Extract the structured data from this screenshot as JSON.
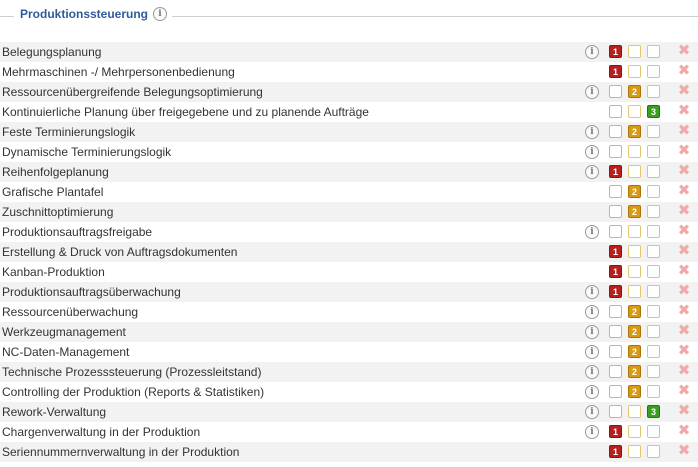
{
  "header": {
    "title": "Produktionssteuerung",
    "info_icon": "info-icon"
  },
  "colors": {
    "level1": "#b52121",
    "level2": "#d99a12",
    "level3": "#3a9f1f",
    "title": "#2f5b9c",
    "delete": "#f0a9a9"
  },
  "rows": [
    {
      "label": "Belegungsplanung",
      "info": true,
      "selected": 1
    },
    {
      "label": "Mehrmaschinen -/ Mehrpersonenbedienung",
      "info": false,
      "selected": 1
    },
    {
      "label": "Ressourcenübergreifende Belegungsoptimierung",
      "info": true,
      "selected": 2
    },
    {
      "label": "Kontinuierliche Planung über freigegebene und zu planende Aufträge",
      "info": false,
      "selected": 3
    },
    {
      "label": "Feste Terminierungslogik",
      "info": true,
      "selected": 2
    },
    {
      "label": "Dynamische Terminierungslogik",
      "info": true,
      "selected": 0
    },
    {
      "label": "Reihenfolgeplanung",
      "info": true,
      "selected": 1
    },
    {
      "label": "Grafische Plantafel",
      "info": false,
      "selected": 2
    },
    {
      "label": "Zuschnittoptimierung",
      "info": false,
      "selected": 2
    },
    {
      "label": "Produktionsauftragsfreigabe",
      "info": true,
      "selected": 0
    },
    {
      "label": "Erstellung & Druck von Auftragsdokumenten",
      "info": false,
      "selected": 1
    },
    {
      "label": "Kanban-Produktion",
      "info": false,
      "selected": 1
    },
    {
      "label": "Produktionsauftragsüberwachung",
      "info": true,
      "selected": 1
    },
    {
      "label": "Ressourcenüberwachung",
      "info": true,
      "selected": 2
    },
    {
      "label": "Werkzeugmanagement",
      "info": true,
      "selected": 2
    },
    {
      "label": "NC-Daten-Management",
      "info": true,
      "selected": 2
    },
    {
      "label": "Technische Prozesssteuerung (Prozessleitstand)",
      "info": true,
      "selected": 2
    },
    {
      "label": "Controlling der Produktion (Reports & Statistiken)",
      "info": true,
      "selected": 2
    },
    {
      "label": "Rework-Verwaltung",
      "info": true,
      "selected": 3
    },
    {
      "label": "Chargenverwaltung in der Produktion",
      "info": true,
      "selected": 1
    },
    {
      "label": "Seriennummernverwaltung in der Produktion",
      "info": false,
      "selected": 1
    }
  ],
  "levels": [
    "1",
    "2",
    "3"
  ],
  "delete_icon": "close-x-icon"
}
